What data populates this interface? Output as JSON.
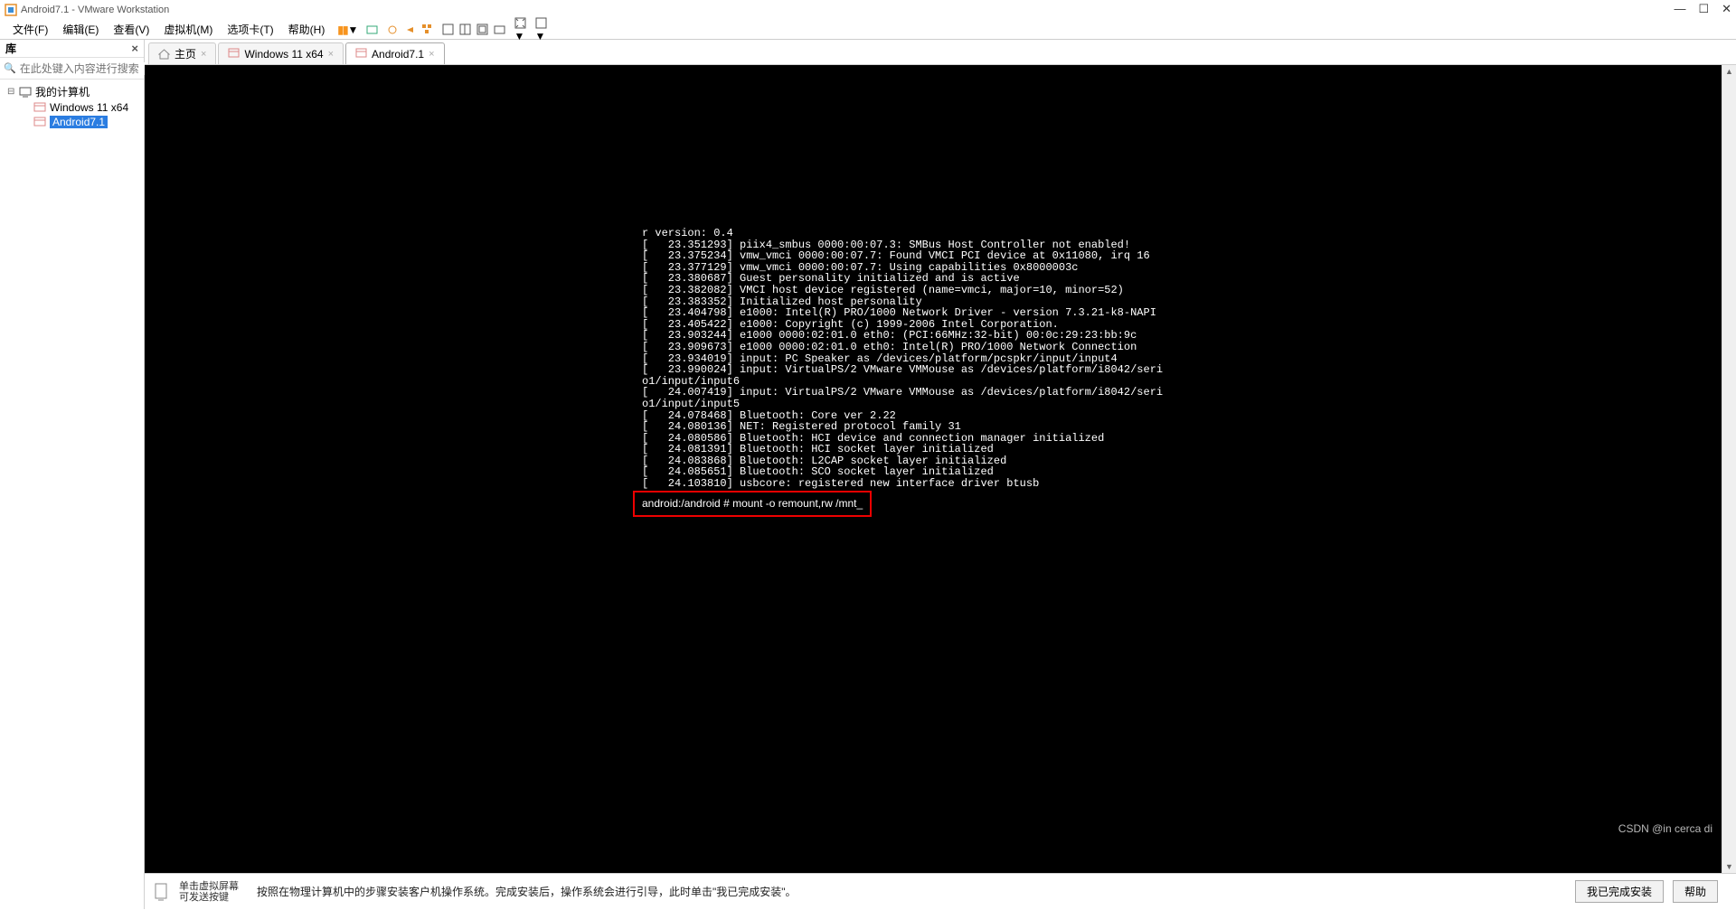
{
  "app": {
    "title": "Android7.1 - VMware Workstation"
  },
  "winctrl": {
    "min": "—",
    "max": "☐",
    "close": "✕"
  },
  "menu": {
    "file": "文件(F)",
    "edit": "编辑(E)",
    "view": "查看(V)",
    "vm": "虚拟机(M)",
    "tabs": "选项卡(T)",
    "help": "帮助(H)"
  },
  "sidebar": {
    "title": "库",
    "search_placeholder": "在此处键入内容进行搜索",
    "root": "我的计算机",
    "items": [
      "Windows 11 x64",
      "Android7.1"
    ],
    "selected_index": 1
  },
  "tabs": {
    "items": [
      {
        "label": "主页",
        "active": false,
        "icon": "home"
      },
      {
        "label": "Windows 11 x64",
        "active": false,
        "icon": "win"
      },
      {
        "label": "Android7.1",
        "active": true,
        "icon": "vm"
      }
    ]
  },
  "console_lines": [
    "r version: 0.4",
    "[   23.351293] piix4_smbus 0000:00:07.3: SMBus Host Controller not enabled!",
    "[   23.375234] vmw_vmci 0000:00:07.7: Found VMCI PCI device at 0x11080, irq 16",
    "[   23.377129] vmw_vmci 0000:00:07.7: Using capabilities 0x8000003c",
    "[   23.380687] Guest personality initialized and is active",
    "[   23.382082] VMCI host device registered (name=vmci, major=10, minor=52)",
    "[   23.383352] Initialized host personality",
    "[   23.404798] e1000: Intel(R) PRO/1000 Network Driver - version 7.3.21-k8-NAPI",
    "[   23.405422] e1000: Copyright (c) 1999-2006 Intel Corporation.",
    "[   23.903244] e1000 0000:02:01.0 eth0: (PCI:66MHz:32-bit) 00:0c:29:23:bb:9c",
    "[   23.909673] e1000 0000:02:01.0 eth0: Intel(R) PRO/1000 Network Connection",
    "[   23.934019] input: PC Speaker as /devices/platform/pcspkr/input/input4",
    "[   23.990024] input: VirtualPS/2 VMware VMMouse as /devices/platform/i8042/seri",
    "o1/input/input6",
    "[   24.007419] input: VirtualPS/2 VMware VMMouse as /devices/platform/i8042/seri",
    "o1/input/input5",
    "[   24.078468] Bluetooth: Core ver 2.22",
    "[   24.080136] NET: Registered protocol family 31",
    "[   24.080586] Bluetooth: HCI device and connection manager initialized",
    "[   24.081391] Bluetooth: HCI socket layer initialized",
    "[   24.083868] Bluetooth: L2CAP socket layer initialized",
    "[   24.085651] Bluetooth: SCO socket layer initialized",
    "[   24.103810] usbcore: registered new interface driver btusb"
  ],
  "command": "android:/android # mount -o remount,rw /mnt_",
  "bottom": {
    "hint_a": "单击虚拟屏幕",
    "hint_b": "可发送按键",
    "message": "按照在物理计算机中的步骤安装客户机操作系统。完成安装后，操作系统会进行引导，此时单击\"我已完成安装\"。",
    "btn_done": "我已完成安装",
    "btn_help": "帮助"
  },
  "watermark": "CSDN @in cerca di"
}
